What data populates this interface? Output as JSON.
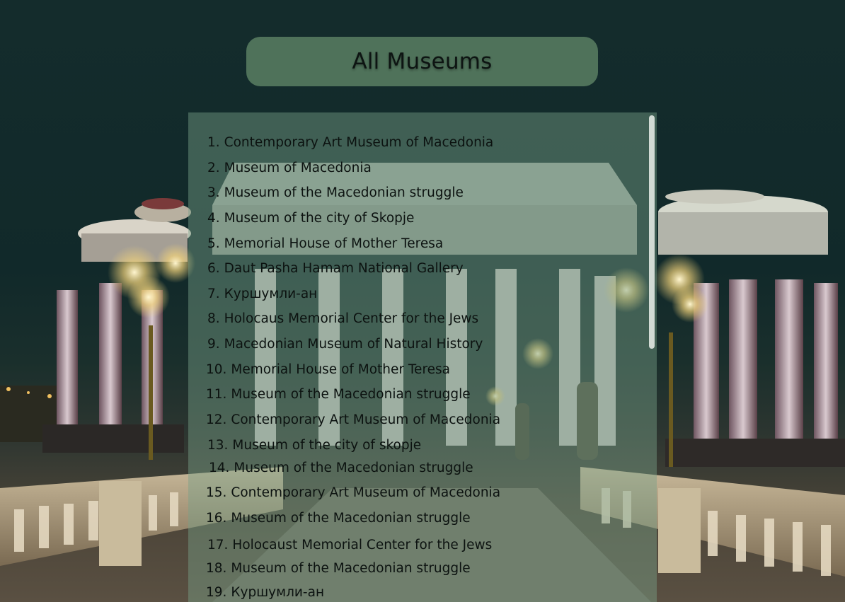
{
  "page": {
    "title": "All Museums"
  },
  "colors": {
    "title_pill": "#608768",
    "panel": "#78a087",
    "text": "#0c1210",
    "scrollbar_thumb": "#ebf0eb"
  },
  "museums": [
    {
      "num": "1.",
      "name": "Contemporary Art Museum of Macedonia"
    },
    {
      "num": "2.",
      "name": "Museum of Macedonia"
    },
    {
      "num": "3.",
      "name": "Museum of the Macedonian struggle"
    },
    {
      "num": "4.",
      "name": "Museum of the city of Skopje"
    },
    {
      "num": "5.",
      "name": "Memorial House of Mother Teresa"
    },
    {
      "num": "6.",
      "name": "Daut Pasha Hamam National Gallery"
    },
    {
      "num": "7.",
      "name": "Куршумли-ан"
    },
    {
      "num": "8.",
      "name": "Holocaus Memorial Center for the Jews"
    },
    {
      "num": "9.",
      "name": "Macedonian Museum of Natural History"
    },
    {
      "num": "10.",
      "name": "Memorial House of Mother Teresa"
    },
    {
      "num": "11.",
      "name": "Museum of the Macedonian struggle"
    },
    {
      "num": "12.",
      "name": "Contemporary Art Museum of Macedonia"
    },
    {
      "num": "13.",
      "name": "Museum of the city of skopje"
    },
    {
      "num": "14.",
      "name": "Museum of the Macedonian struggle"
    },
    {
      "num": "15.",
      "name": "Contemporary Art Museum of Macedonia"
    },
    {
      "num": "16.",
      "name": "Museum of the Macedonian struggle"
    },
    {
      "num": "17.",
      "name": "Holocaust Memorial Center for the Jews"
    },
    {
      "num": "18.",
      "name": "Museum of the Macedonian struggle"
    },
    {
      "num": "19.",
      "name": "Куршумли-ан"
    }
  ]
}
